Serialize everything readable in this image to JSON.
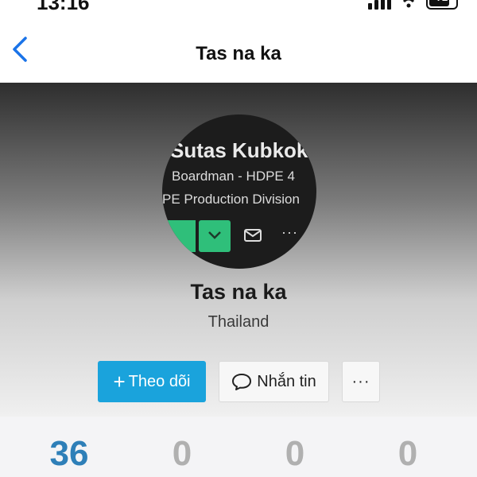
{
  "status_bar": {
    "time": "13:16",
    "battery_level": "72"
  },
  "nav": {
    "title": "Tas na ka",
    "back_icon": "chevron-left-icon"
  },
  "profile": {
    "avatar_text": {
      "name": "Sutas Kubkokk",
      "line2": "Boardman - HDPE 4",
      "line3": "PE Production Division"
    },
    "name": "Tas na ka",
    "country": "Thailand"
  },
  "actions": {
    "follow_label": "Theo dõi",
    "follow_prefix": "+",
    "message_label": "Nhắn tin",
    "more_label": "···"
  },
  "stats": {
    "values": [
      "36",
      "0",
      "0",
      "0"
    ]
  },
  "colors": {
    "accent": "#1aa3dc",
    "active_stat": "#2e7fb8",
    "back_icon": "#1a73e8"
  }
}
